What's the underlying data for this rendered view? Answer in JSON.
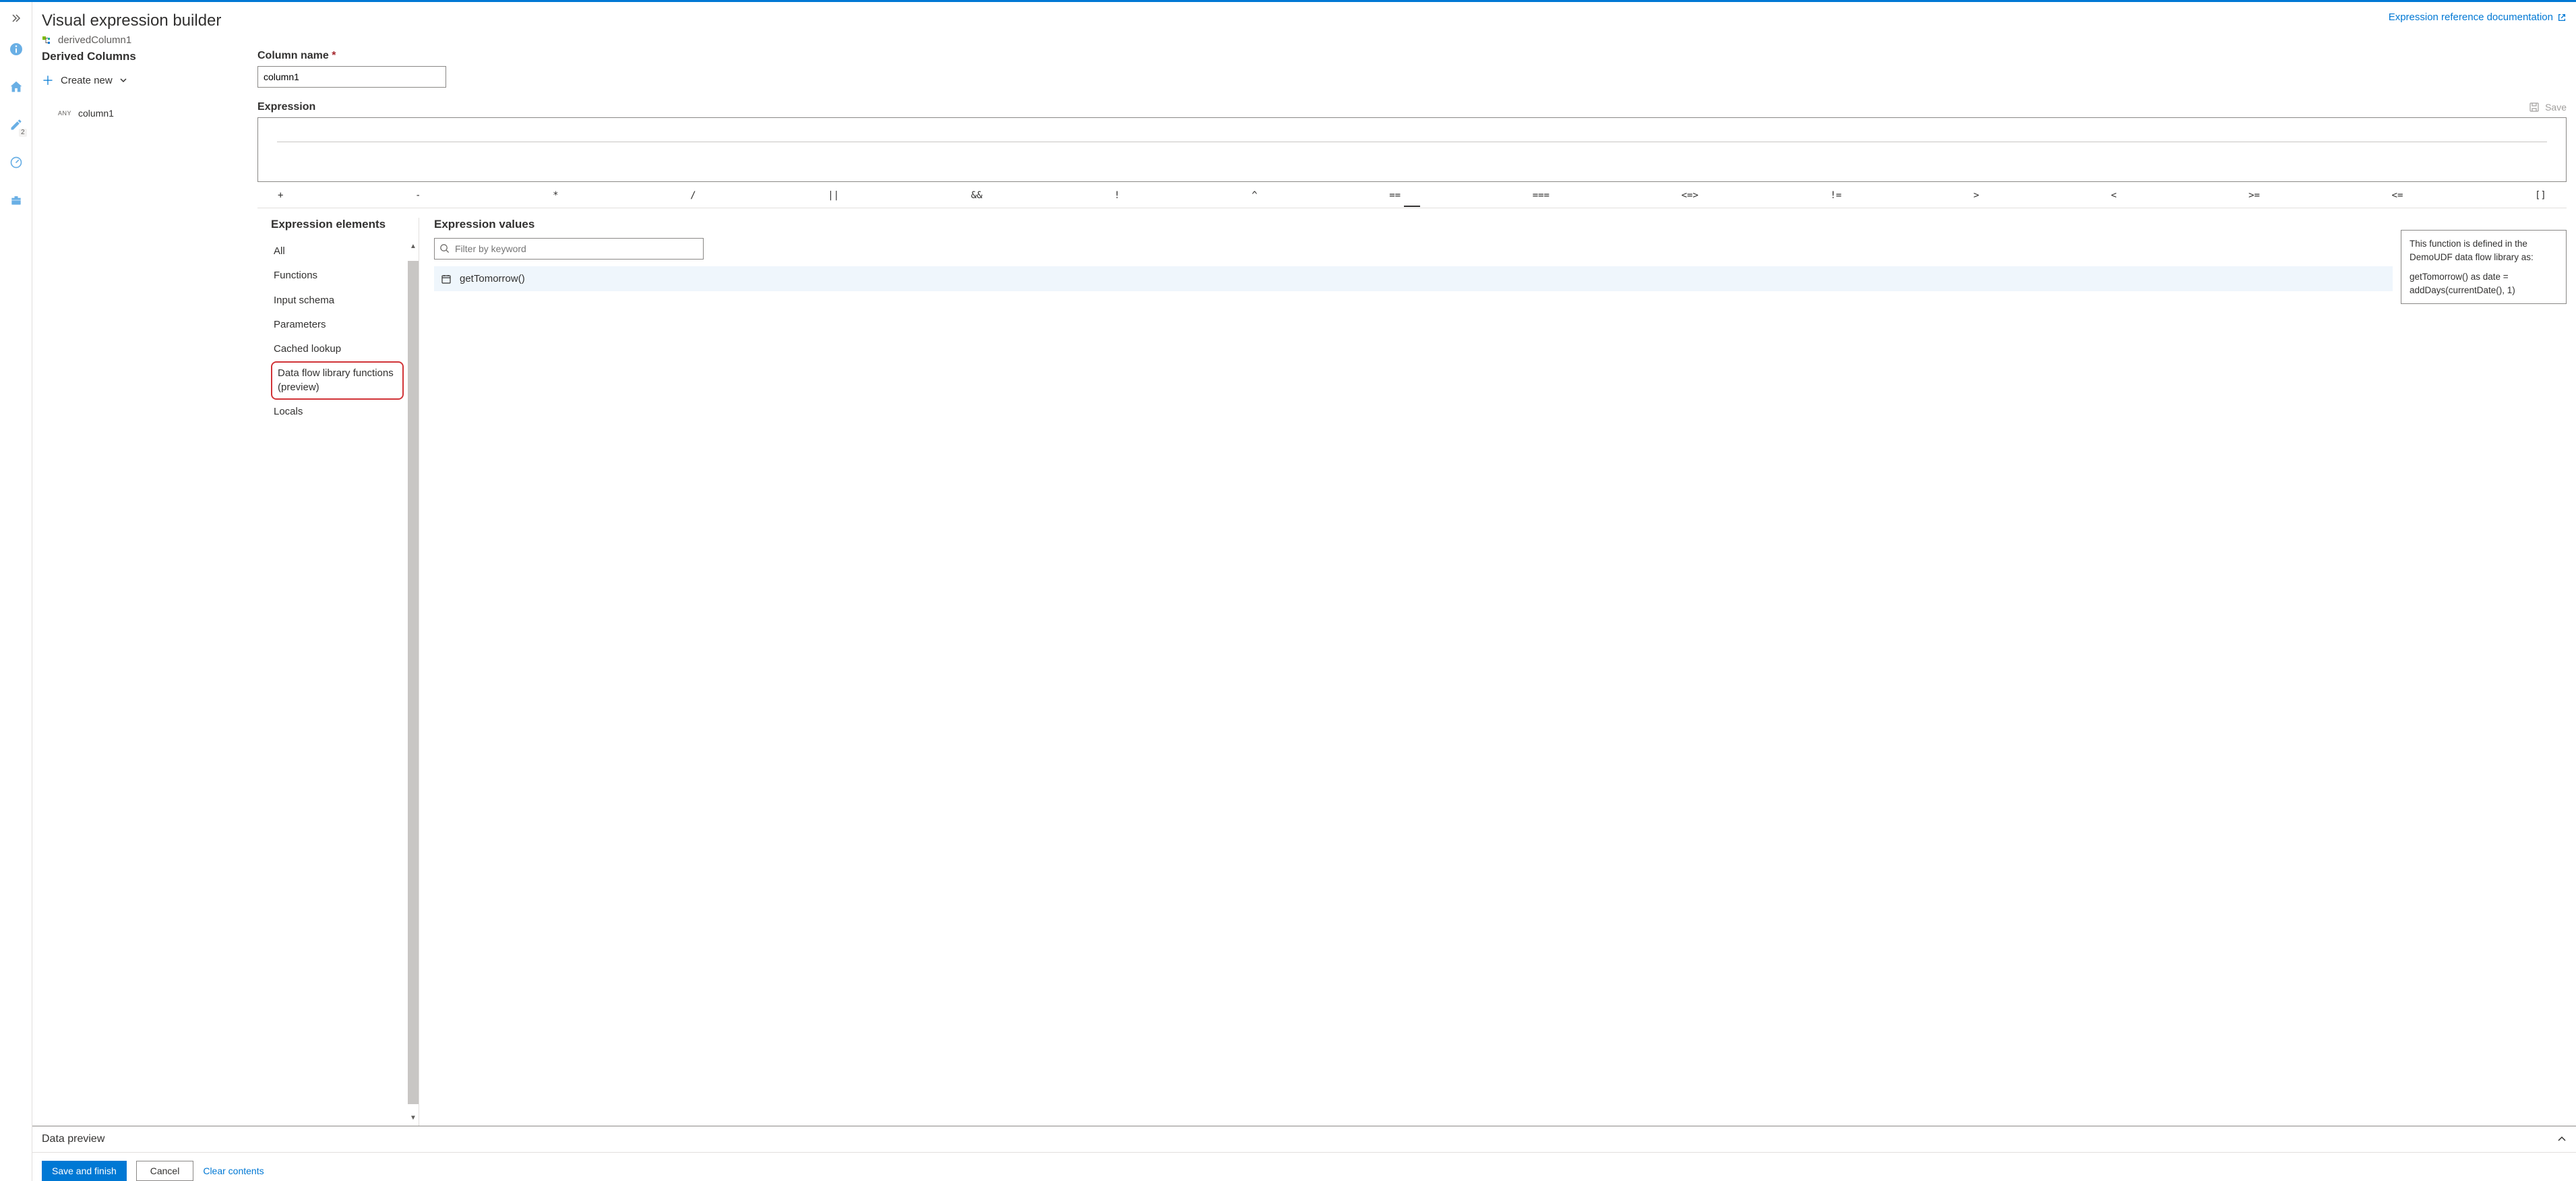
{
  "leftRail": {
    "pencilBadge": "2"
  },
  "header": {
    "title": "Visual expression builder",
    "breadcrumb": "derivedColumn1",
    "docLink": "Expression reference documentation"
  },
  "derived": {
    "title": "Derived Columns",
    "createNew": "Create new",
    "column": {
      "badge": "ANY",
      "name": "column1"
    }
  },
  "form": {
    "columnNameLabel": "Column name",
    "columnNameValue": "column1",
    "expressionLabel": "Expression",
    "save": "Save"
  },
  "operators": [
    "+",
    "-",
    "*",
    "/",
    "||",
    "&&",
    "!",
    "^",
    "==",
    "===",
    "<=>",
    "!=",
    ">",
    "<",
    ">=",
    "<=",
    "[]"
  ],
  "elements": {
    "title": "Expression elements",
    "items": [
      {
        "label": "All",
        "highlight": false
      },
      {
        "label": "Functions",
        "highlight": false
      },
      {
        "label": "Input schema",
        "highlight": false
      },
      {
        "label": "Parameters",
        "highlight": false
      },
      {
        "label": "Cached lookup",
        "highlight": false
      },
      {
        "label": "Data flow library functions (preview)",
        "highlight": true
      },
      {
        "label": "Locals",
        "highlight": false
      }
    ]
  },
  "values": {
    "title": "Expression values",
    "filterPlaceholder": "Filter by keyword",
    "row": "getTomorrow()"
  },
  "tooltip": {
    "line1": "This function is defined in the DemoUDF data flow library as:",
    "line2": "getTomorrow() as date = addDays(currentDate(), 1)"
  },
  "preview": {
    "title": "Data preview"
  },
  "footer": {
    "save": "Save and finish",
    "cancel": "Cancel",
    "clear": "Clear contents"
  }
}
